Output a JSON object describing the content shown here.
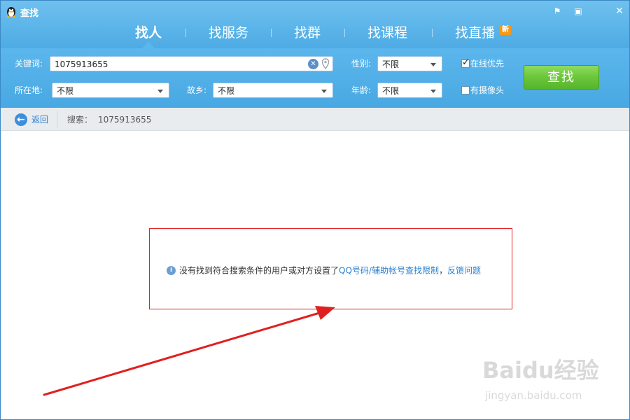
{
  "window": {
    "title": "查找",
    "controls": {
      "feedback": "⚑",
      "minimize": "▣",
      "close": "✕"
    }
  },
  "tabs": [
    {
      "label": "找人",
      "active": true
    },
    {
      "label": "找服务",
      "active": false
    },
    {
      "label": "找群",
      "active": false
    },
    {
      "label": "找课程",
      "active": false
    },
    {
      "label": "找直播",
      "active": false,
      "badge": "新"
    }
  ],
  "filters": {
    "keyword_label": "关键词:",
    "keyword_value": "1075913655",
    "location_label": "所在地:",
    "location_value": "不限",
    "hometown_label": "故乡:",
    "hometown_value": "不限",
    "gender_label": "性别:",
    "gender_value": "不限",
    "age_label": "年龄:",
    "age_value": "不限",
    "online_first_label": "在线优先",
    "online_first_checked": true,
    "has_camera_label": "有摄像头",
    "has_camera_checked": false,
    "search_button": "查找"
  },
  "navbar": {
    "back_label": "返回",
    "search_label": "搜索：",
    "search_value": "1075913655"
  },
  "result": {
    "message": "没有找到符合搜索条件的用户或对方设置了",
    "link_restriction": "QQ号码/辅助帐号查找限制",
    "separator": "，",
    "link_feedback": "反馈问题"
  },
  "watermark": {
    "logo": "Baidu经验",
    "url": "jingyan.baidu.com"
  },
  "colors": {
    "header_blue": "#4aa8e2",
    "search_green": "#6bc63c",
    "link_blue": "#2a7fd0",
    "annotation_red": "#e02020"
  }
}
